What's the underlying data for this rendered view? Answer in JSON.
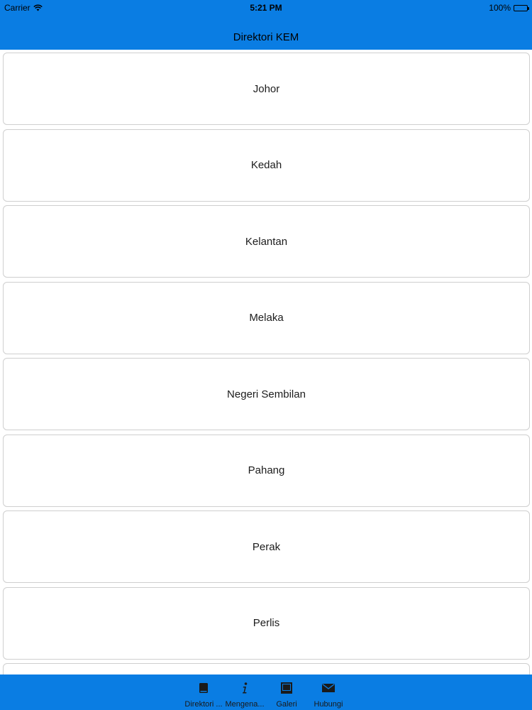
{
  "status_bar": {
    "carrier": "Carrier",
    "time": "5:21 PM",
    "battery": "100%"
  },
  "header": {
    "title": "Direktori KEM"
  },
  "list": {
    "items": [
      {
        "label": "Johor"
      },
      {
        "label": "Kedah"
      },
      {
        "label": "Kelantan"
      },
      {
        "label": "Melaka"
      },
      {
        "label": "Negeri Sembilan"
      },
      {
        "label": "Pahang"
      },
      {
        "label": "Perak"
      },
      {
        "label": "Perlis"
      },
      {
        "label": ""
      }
    ]
  },
  "tabbar": {
    "tabs": [
      {
        "label": "Direktori ...",
        "icon": "book-icon"
      },
      {
        "label": "Mengena...",
        "icon": "info-icon"
      },
      {
        "label": "Galeri",
        "icon": "image-icon"
      },
      {
        "label": "Hubungi",
        "icon": "mail-icon"
      }
    ]
  },
  "colors": {
    "bar_blue": "#0a7de3",
    "row_border": "#cfcfcf"
  }
}
